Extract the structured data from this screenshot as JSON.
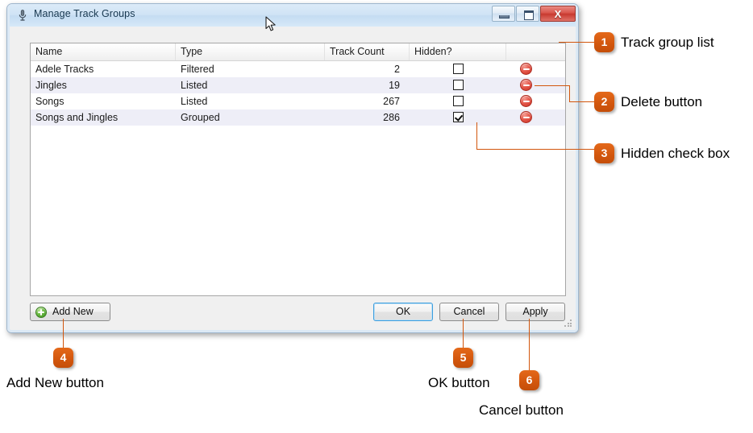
{
  "window": {
    "title": "Manage Track Groups",
    "title_icon": "microphone-icon",
    "controls": {
      "minimize": "minimize-icon",
      "maximize": "maximize-icon",
      "close_label": "X"
    }
  },
  "grid": {
    "columns": [
      "Name",
      "Type",
      "Track Count",
      "Hidden?",
      ""
    ],
    "rows": [
      {
        "name": "Adele Tracks",
        "type": "Filtered",
        "count": "2",
        "hidden": false
      },
      {
        "name": "Jingles",
        "type": "Listed",
        "count": "19",
        "hidden": false
      },
      {
        "name": "Songs",
        "type": "Listed",
        "count": "267",
        "hidden": false
      },
      {
        "name": "Songs and Jingles",
        "type": "Grouped",
        "count": "286",
        "hidden": true
      }
    ]
  },
  "buttons": {
    "add_new": "Add New",
    "ok": "OK",
    "cancel": "Cancel",
    "apply": "Apply"
  },
  "callouts": [
    {
      "number": "1",
      "label": "Track group list"
    },
    {
      "number": "2",
      "label": "Delete button"
    },
    {
      "number": "3",
      "label": "Hidden check box"
    },
    {
      "number": "4",
      "label": "Add New button"
    },
    {
      "number": "5",
      "label": "OK button"
    },
    {
      "number": "6",
      "label": "Cancel button"
    }
  ],
  "colors": {
    "accent": "#d2560d",
    "delete_icon": "#c93124",
    "add_icon": "#67b83f",
    "titlebar": "#cfe3f5",
    "row_alt": "#eeeef7"
  }
}
